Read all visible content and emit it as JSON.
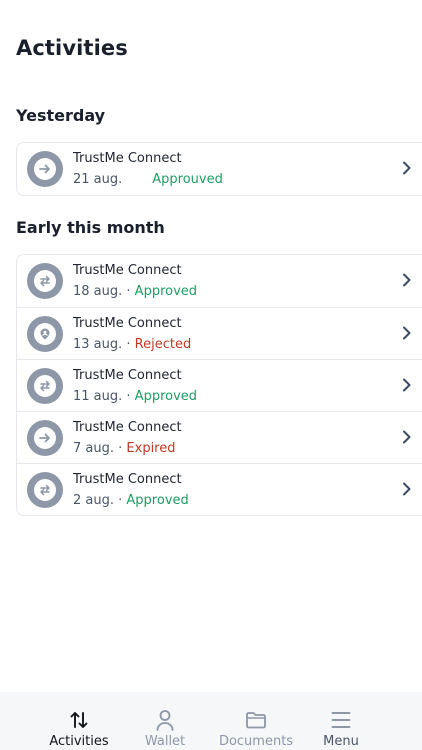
{
  "header": {
    "title": "Activities"
  },
  "sections": [
    {
      "title": "Yesterday",
      "items": [
        {
          "name": "TrustMe Connect",
          "date": "21 aug.",
          "separator": "",
          "status": "Approuved",
          "status_kind": "ok",
          "icon": "arrow-right-icon"
        }
      ]
    },
    {
      "title": "Early this month",
      "items": [
        {
          "name": "TrustMe Connect",
          "date": "18 aug.",
          "separator": " · ",
          "status": "Approved",
          "status_kind": "ok",
          "icon": "swap-icon"
        },
        {
          "name": "TrustMe Connect",
          "date": "13 aug.",
          "separator": " · ",
          "status": "Rejected",
          "status_kind": "bad",
          "icon": "user-pin-icon"
        },
        {
          "name": "TrustMe Connect",
          "date": "11 aug.",
          "separator": " · ",
          "status": "Approved",
          "status_kind": "ok",
          "icon": "swap-icon"
        },
        {
          "name": "TrustMe Connect",
          "date": "7 aug.",
          "separator": " · ",
          "status": "Expired",
          "status_kind": "bad",
          "icon": "arrow-right-icon"
        },
        {
          "name": "TrustMe Connect",
          "date": "2 aug.",
          "separator": " · ",
          "status": "Approved",
          "status_kind": "ok",
          "icon": "swap-icon"
        }
      ]
    }
  ],
  "tabbar": {
    "tabs": [
      {
        "label": "Activities",
        "icon": "sort-arrows-icon",
        "active": true
      },
      {
        "label": "Wallet",
        "icon": "person-icon",
        "active": false
      },
      {
        "label": "Documents",
        "icon": "folder-icon",
        "active": false
      },
      {
        "label": "Menu",
        "icon": "hamburger-icon",
        "active": false
      }
    ]
  },
  "colors": {
    "approved": "#1f9d62",
    "rejected": "#c0392b",
    "avatar": "#8d97a8",
    "tabbar_bg": "#f6f7f9"
  }
}
